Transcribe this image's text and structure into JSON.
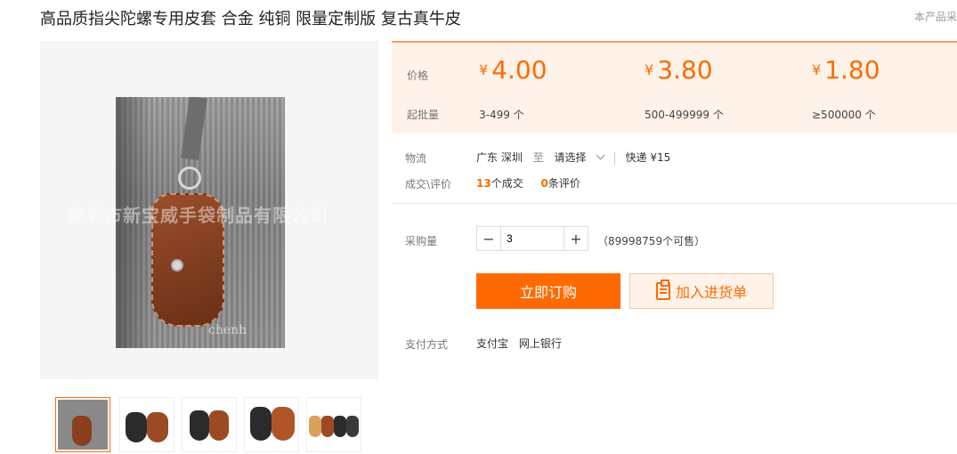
{
  "product": {
    "title": "高品质指尖陀螺专用皮套 合金 纯铜 限量定制版 复古真牛皮",
    "side_note": "本产品采"
  },
  "gallery": {
    "watermark": "深圳市新宝威手袋制品有限公司",
    "image_text": "chenh",
    "thumbnail_count": 5
  },
  "pricing": {
    "price_label": "价格",
    "qty_label": "起批量",
    "tiers": [
      {
        "currency": "¥",
        "price": "4.00",
        "range": "3-499 个"
      },
      {
        "currency": "¥",
        "price": "3.80",
        "range": "500-499999 个"
      },
      {
        "currency": "¥",
        "price": "1.80",
        "range": "≥500000 个"
      }
    ]
  },
  "logistics": {
    "label": "物流",
    "origin": "广东 深圳",
    "to": "至",
    "destination": "请选择",
    "shipping": "快递 ¥15"
  },
  "deals": {
    "label": "成交\\评价",
    "deal_count": "13",
    "deal_suffix": "个成交",
    "review_count": "0",
    "review_suffix": "条评价"
  },
  "purchase": {
    "label": "采购量",
    "minus": "−",
    "plus": "+",
    "quantity": "3",
    "stock": "（89998759个可售）"
  },
  "actions": {
    "buy_label": "立即订购",
    "cart_label": "加入进货单"
  },
  "payment": {
    "label": "支付方式",
    "methods": [
      "支付宝",
      "网上银行"
    ]
  },
  "colors": {
    "accent": "#ff6a00",
    "price_bg": "#fff2e8"
  }
}
